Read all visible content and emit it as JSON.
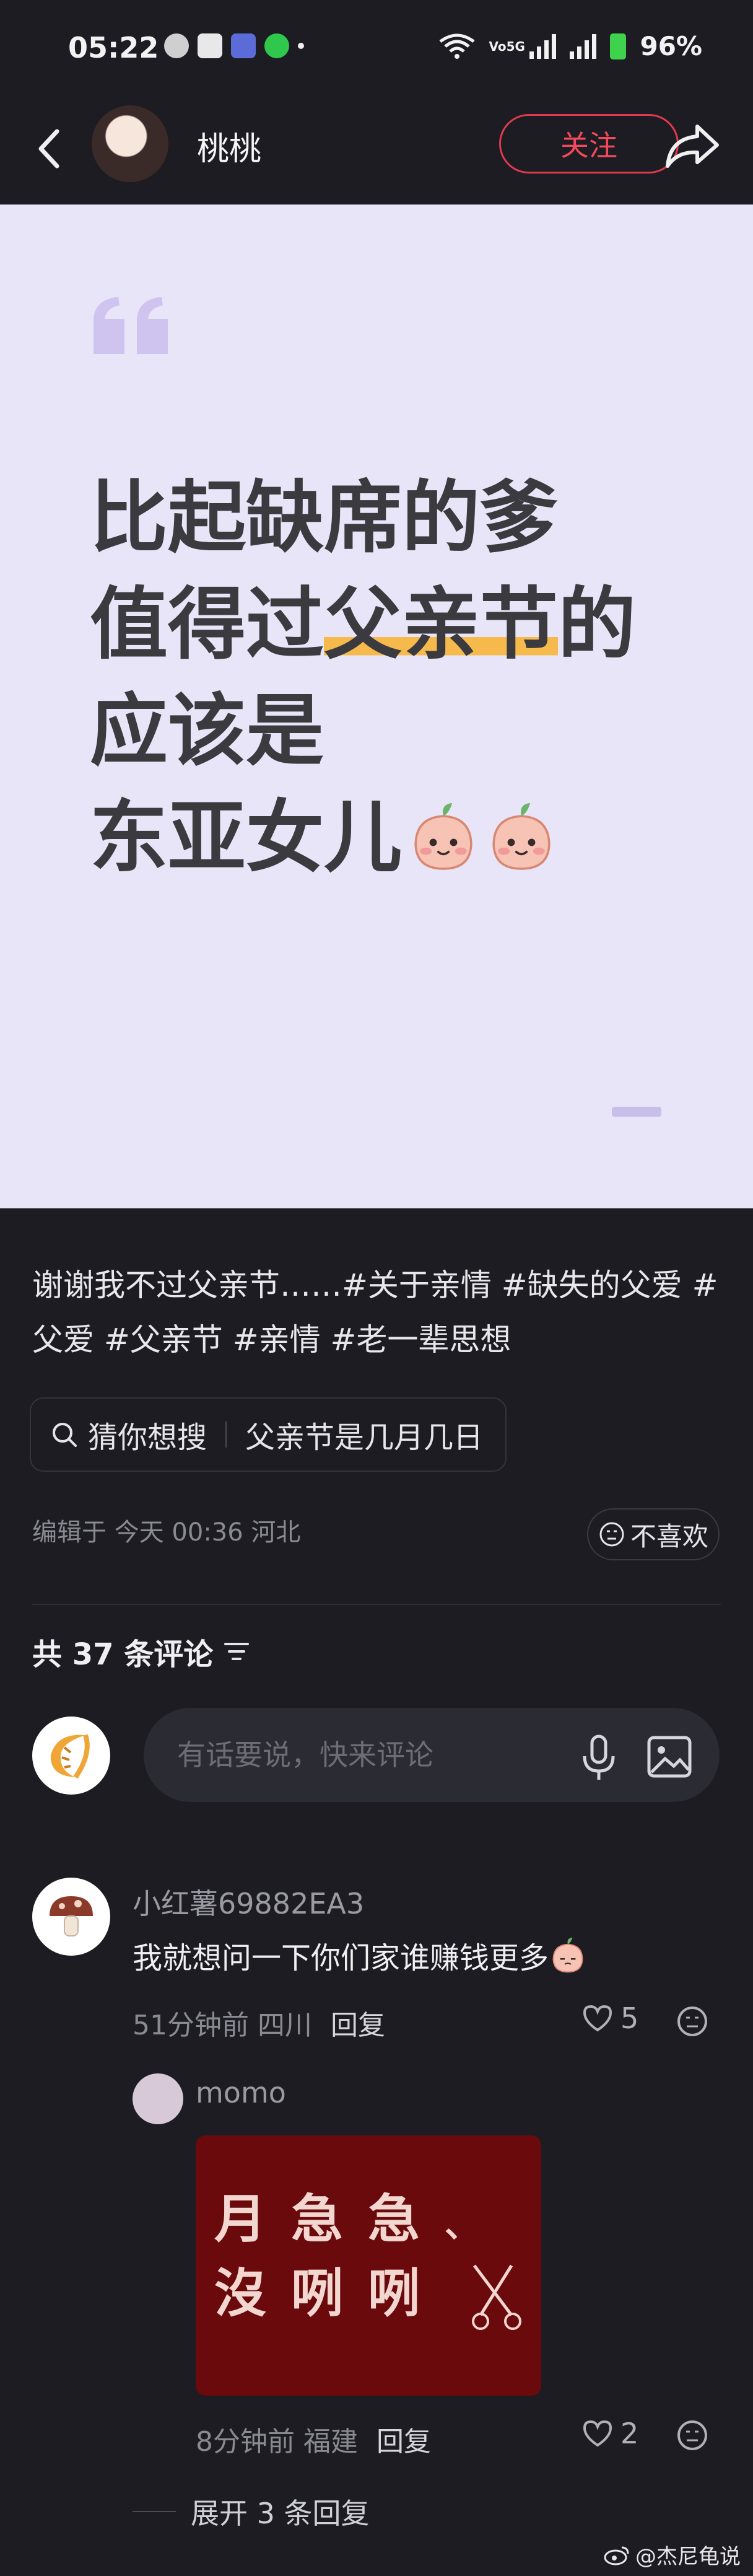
{
  "status_bar": {
    "time": "05:22",
    "battery": "96%"
  },
  "header": {
    "author_name": "桃桃",
    "follow_label": "关注"
  },
  "card": {
    "lines": [
      "比起缺席的爹",
      "值得过",
      "父亲节",
      "的",
      "应该是",
      "东亚女儿"
    ]
  },
  "post": {
    "description": "谢谢我不过父亲节……#关于亲情 #缺失的父爱 #父爱 #父亲节 #亲情 #老一辈思想",
    "guess_label": "猜你想搜",
    "guess_query": "父亲节是几月几日",
    "edited_info": "编辑于  今天 00:36 河北",
    "dislike_label": "不喜欢"
  },
  "comments_section": {
    "count_label": "共 37 条评论",
    "input_placeholder": "有话要说，快来评论"
  },
  "comment1": {
    "username": "小红薯69882EA3",
    "text": "我就想问一下你们家谁赚钱更多",
    "meta": "51分钟前 四川",
    "reply_label": "回复",
    "likes": "5"
  },
  "reply1": {
    "username": "momo",
    "image_text": [
      "月",
      "急",
      "急",
      "沒",
      "咧",
      "咧",
      "、"
    ],
    "meta": "8分钟前 福建",
    "reply_label": "回复",
    "likes": "2"
  },
  "expand_label": "展开 3 条回复",
  "watermark": "@杰尼龟说",
  "colors": {
    "accent": "#e03a4e",
    "card_bg": "#e8e5f8",
    "highlight": "#f6b94b",
    "page_bg": "#1c1c22"
  }
}
